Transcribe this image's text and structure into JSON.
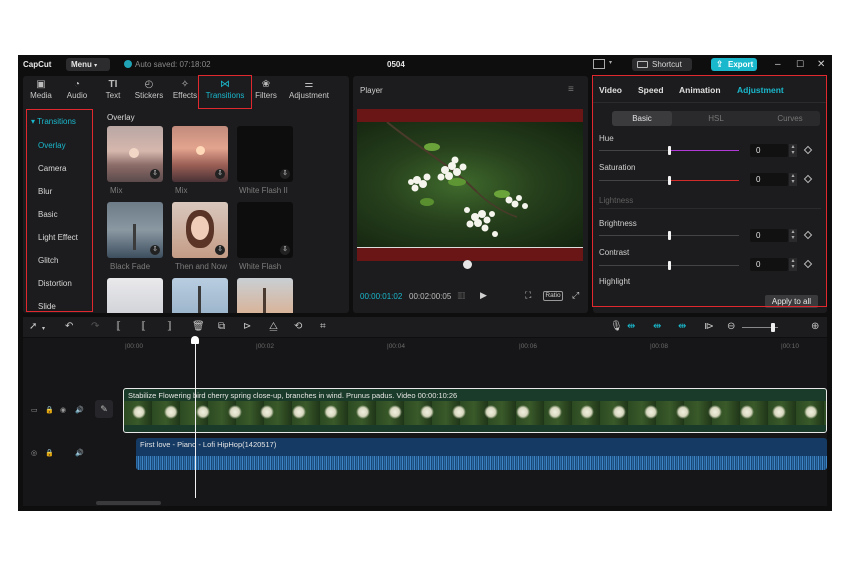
{
  "titlebar": {
    "logo": "CapCut",
    "menu": "Menu",
    "autosave": "Auto saved: 07:18:02",
    "project_name": "0504",
    "shortcut": "Shortcut",
    "export": "Export"
  },
  "media_tabs": [
    {
      "label": "Media",
      "icon": "media-icon"
    },
    {
      "label": "Audio",
      "icon": "audio-icon"
    },
    {
      "label": "Text",
      "icon": "text-icon"
    },
    {
      "label": "Stickers",
      "icon": "stickers-icon"
    },
    {
      "label": "Effects",
      "icon": "effects-icon"
    },
    {
      "label": "Transitions",
      "icon": "transitions-icon"
    },
    {
      "label": "Filters",
      "icon": "filters-icon"
    },
    {
      "label": "Adjustment",
      "icon": "adjustment-icon"
    }
  ],
  "active_media_tab": "Transitions",
  "categories": {
    "header": "Transitions",
    "items": [
      "Overlay",
      "Camera",
      "Blur",
      "Basic",
      "Light Effect",
      "Glitch",
      "Distortion",
      "Slide"
    ],
    "selected": "Overlay"
  },
  "gallery": {
    "section_title": "Overlay",
    "items": [
      "Mix",
      "Mix",
      "White Flash II",
      "Black Fade",
      "Then and Now",
      "White Flash"
    ]
  },
  "player": {
    "title": "Player",
    "current_time": "00:00:01:02",
    "total_time": "00:02:00:05",
    "ratio": "Ratio"
  },
  "inspector": {
    "tabs": [
      "Video",
      "Speed",
      "Animation",
      "Adjustment"
    ],
    "active_tab": "Adjustment",
    "sub_tabs": [
      "Basic",
      "HSL",
      "Curves"
    ],
    "active_sub_tab": "Basic",
    "params": [
      {
        "label": "Hue",
        "value": "0",
        "level": 0.5
      },
      {
        "label": "Saturation",
        "value": "0",
        "level": 0.5
      }
    ],
    "section": "Lightness",
    "lightness_params": [
      {
        "label": "Brightness",
        "value": "0",
        "level": 0.5
      },
      {
        "label": "Contrast",
        "value": "0",
        "level": 0.5
      }
    ],
    "highlight_label": "Highlight",
    "apply_all": "Apply to all"
  },
  "timeline": {
    "ruler": [
      "|00:00",
      "|00:02",
      "|00:04",
      "|00:06",
      "|00:08",
      "|00:10"
    ],
    "video_clip": "Stabilize  Flowering bird cherry spring close-up, branches in wind. Prunus padus. Video  00:00:10:26",
    "audio_clip": "First love - Piano - Lofi HipHop(1420517)"
  },
  "colors": {
    "accent": "#1ab8cc",
    "highlight_box": "#e0282e"
  }
}
